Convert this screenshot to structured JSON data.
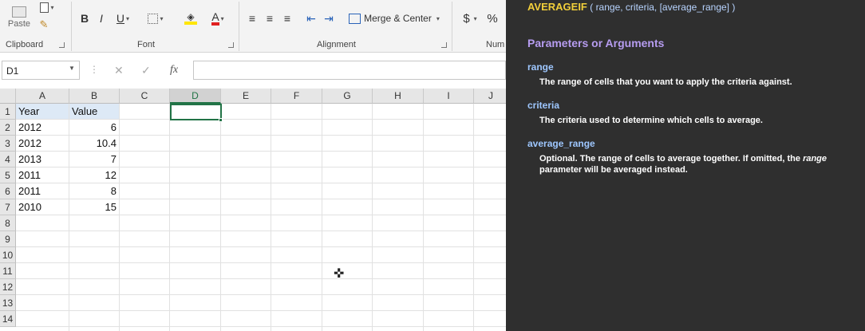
{
  "ribbon": {
    "paste_label": "Paste",
    "groups": {
      "clipboard": "Clipboard",
      "font": "Font",
      "alignment": "Alignment",
      "number": "Num"
    },
    "bold": "B",
    "italic": "I",
    "underline": "U",
    "merge_center": "Merge & Center",
    "currency": "$",
    "percent": "%",
    "icons": [
      "paste-icon",
      "copy-icon",
      "format-painter-icon",
      "border-icon",
      "fill-color-icon",
      "font-color-icon",
      "align-left-icon",
      "align-center-icon",
      "align-right-icon",
      "decrease-indent-icon",
      "increase-indent-icon",
      "merge-icon"
    ]
  },
  "formula_bar": {
    "name_box": "D1",
    "fx": "fx",
    "cancel": "✕",
    "enter": "✓",
    "content": ""
  },
  "sheet": {
    "columns": [
      "A",
      "B",
      "C",
      "D",
      "E",
      "F",
      "G",
      "H",
      "I",
      "J"
    ],
    "selected_column": "D",
    "rows": [
      "1",
      "2",
      "3",
      "4",
      "5",
      "6",
      "7",
      "8",
      "9",
      "10",
      "11",
      "12",
      "13",
      "14"
    ],
    "headers": {
      "year": "Year",
      "value": "Value"
    },
    "data": [
      {
        "year": "2012",
        "value": "6"
      },
      {
        "year": "2012",
        "value": "10.4"
      },
      {
        "year": "2013",
        "value": "7"
      },
      {
        "year": "2011",
        "value": "12"
      },
      {
        "year": "2011",
        "value": "8"
      },
      {
        "year": "2010",
        "value": "15"
      }
    ]
  },
  "help": {
    "function_name": "AVERAGEIF",
    "signature": "( range, criteria, [average_range] )",
    "section_title": "Parameters or Arguments",
    "params": [
      {
        "name": "range",
        "description": "The range of cells that you want to apply the criteria against."
      },
      {
        "name": "criteria",
        "description": "The criteria used to determine which cells to average."
      },
      {
        "name": "average_range",
        "description_pre": "Optional. The range of cells to average together. If omitted, the ",
        "description_em": "range",
        "description_post": " parameter will be averaged instead."
      }
    ]
  },
  "colors": {
    "excel_green": "#217346",
    "help_bg": "#2f2f2f",
    "fn_yellow": "#f2cf3a",
    "section_purple": "#b69cf0",
    "param_blue": "#9ec7ff",
    "header_fill": "#dde9f6"
  }
}
